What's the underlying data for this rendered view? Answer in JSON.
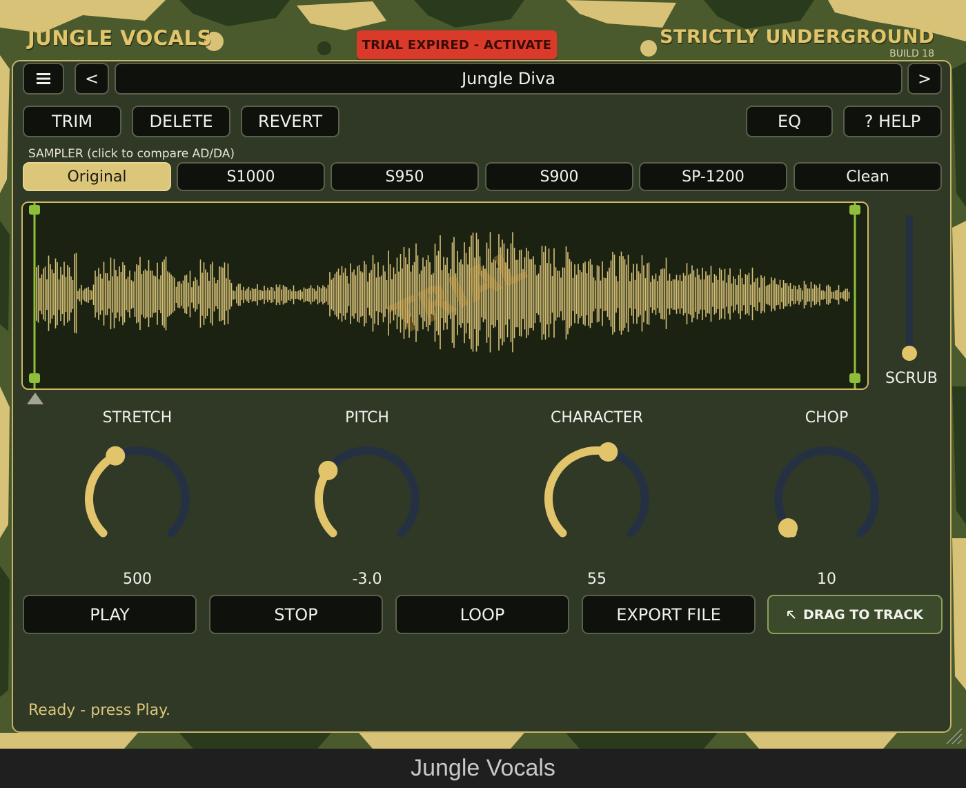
{
  "header": {
    "brand_left": "JUNGLE VOCALS",
    "brand_right": "STRICTLY UNDERGROUND",
    "build": "BUILD 18",
    "trial_button": "TRIAL EXPIRED - ACTIVATE"
  },
  "nav": {
    "menu_icon": "hamburger-icon",
    "prev_label": "<",
    "next_label": ">",
    "preset_name": "Jungle Diva"
  },
  "edit": {
    "trim": "TRIM",
    "delete": "DELETE",
    "revert": "REVERT",
    "eq": "EQ",
    "help": "? HELP"
  },
  "sampler": {
    "label": "SAMPLER  (click to compare AD/DA)",
    "options": [
      "Original",
      "S1000",
      "S950",
      "S900",
      "SP-1200",
      "Clean"
    ],
    "selected": "Original"
  },
  "waveform": {
    "watermark": "TRIAL",
    "color": "#d8c277"
  },
  "scrub": {
    "label": "SCRUB",
    "level": 0.0
  },
  "knobs": [
    {
      "label": "STRETCH",
      "value": "500",
      "fraction": 0.4
    },
    {
      "label": "PITCH",
      "value": "-3.0",
      "fraction": 0.3
    },
    {
      "label": "CHARACTER",
      "value": "55",
      "fraction": 0.55
    },
    {
      "label": "CHOP",
      "value": "10",
      "fraction": 0.03
    }
  ],
  "transport": {
    "play": "PLAY",
    "stop": "STOP",
    "loop": "LOOP",
    "export": "EXPORT FILE",
    "drag": "DRAG TO TRACK",
    "drag_icon": "drag-arrow-icon"
  },
  "status": "Ready - press Play.",
  "window_title": "Jungle Vocals",
  "colors": {
    "accent": "#e2c46b",
    "panel": "#2f3926",
    "button": "#0f110d",
    "trial": "#d93a2a",
    "knob_track": "#253143",
    "marker": "#8fbf3a"
  }
}
